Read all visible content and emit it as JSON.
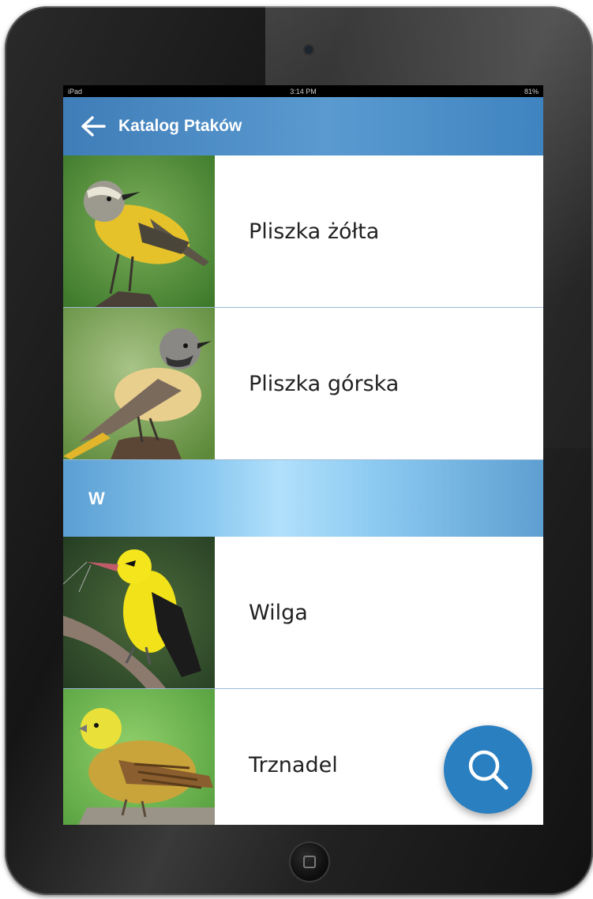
{
  "status_bar": {
    "carrier": "iPad",
    "time": "3:14 PM",
    "battery": "81%"
  },
  "app_bar": {
    "title": "Katalog Ptaków",
    "back_icon": "arrow-left-icon",
    "background": "#4a8cc6"
  },
  "list": {
    "items_before": [
      {
        "label": "Pliszka żółta",
        "image": "yellow-wagtail-photo"
      },
      {
        "label": "Pliszka górska",
        "image": "grey-wagtail-photo"
      }
    ],
    "section_header": "W",
    "items_after": [
      {
        "label": "Wilga",
        "image": "golden-oriole-photo"
      },
      {
        "label": "Trznadel",
        "image": "yellowhammer-photo"
      }
    ]
  },
  "fab": {
    "icon": "search-icon",
    "color": "#2a7fc1"
  }
}
